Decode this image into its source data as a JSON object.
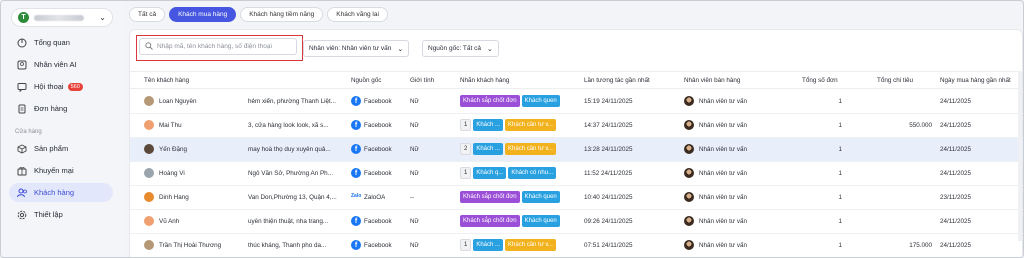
{
  "sidebar": {
    "store_initial": "T",
    "items": [
      {
        "label": "Tổng quan",
        "icon": "dashboard-icon"
      },
      {
        "label": "Nhân viên AI",
        "icon": "ai-agent-icon"
      },
      {
        "label": "Hội thoại",
        "icon": "chat-icon",
        "badge": "560"
      },
      {
        "label": "Đơn hàng",
        "icon": "order-icon"
      },
      {
        "label": "Sản phẩm",
        "icon": "box-icon"
      },
      {
        "label": "Khuyến mại",
        "icon": "promotion-icon"
      },
      {
        "label": "Khách hàng",
        "icon": "customers-icon",
        "active": true
      },
      {
        "label": "Thiết lập",
        "icon": "settings-icon"
      }
    ],
    "section_label": "Cửa hàng"
  },
  "tabs": [
    "Tất cả",
    "Khách mua hàng",
    "Khách hàng tiềm năng",
    "Khách vãng lai"
  ],
  "active_tab": 1,
  "search": {
    "placeholder": "Nhập mã, tên khách hàng, số điện thoại"
  },
  "filters": {
    "staff": "Nhân viên: Nhân viên tư vấn",
    "source": "Nguồn gốc: Tất cả"
  },
  "columns": [
    "Tên khách hàng",
    "Nguồn gốc",
    "Giới tính",
    "Nhãn khách hàng",
    "Lần tương tác gần nhất",
    "Nhân viên bán hàng",
    "Tổng số đơn",
    "Tổng chi tiêu",
    "Ngày mua hàng gần nhất"
  ],
  "rows": [
    {
      "name": "Loan Nguyễn",
      "address": "hẻm xiển, phường Thanh Liệt...",
      "source": "Facebook",
      "gender": "Nữ",
      "tag_count": "",
      "tags": [
        {
          "text": "Khách sắp chốt đơn",
          "color": "purple"
        },
        {
          "text": "Khách quen",
          "color": "blue"
        }
      ],
      "last_interaction": "15:19 24/11/2025",
      "staff": "Nhân viên tư vấn",
      "orders": "1",
      "spend": "",
      "last_purchase": "24/11/2025"
    },
    {
      "name": "Mai Thu",
      "address": "3, cửa hàng look look, xã s...",
      "source": "Facebook",
      "gender": "Nữ",
      "tag_count": "1",
      "tags": [
        {
          "text": "Khách ...",
          "color": "blue"
        },
        {
          "text": "Khách cần tư v...",
          "color": "yellow"
        }
      ],
      "last_interaction": "14:37 24/11/2025",
      "staff": "Nhân viên tư vấn",
      "orders": "1",
      "spend": "550.000",
      "last_purchase": "24/11/2025"
    },
    {
      "name": "Yến Đặng",
      "address": "may hoà thọ duy xuyên quả...",
      "source": "Facebook",
      "gender": "Nữ",
      "tag_count": "2",
      "tags": [
        {
          "text": "Khách ...",
          "color": "blue"
        },
        {
          "text": "Khách cần tư v...",
          "color": "yellow"
        }
      ],
      "last_interaction": "13:28 24/11/2025",
      "staff": "Nhân viên tư vấn",
      "orders": "1",
      "spend": "",
      "last_purchase": "24/11/2025"
    },
    {
      "name": "Hoàng Vi",
      "address": "Ngô Văn Sở, Phường An Ph...",
      "source": "Facebook",
      "gender": "Nữ",
      "tag_count": "1",
      "tags": [
        {
          "text": "Khách q...",
          "color": "blue"
        },
        {
          "text": "Khách có nhu...",
          "color": "blue"
        }
      ],
      "last_interaction": "11:52 24/11/2025",
      "staff": "Nhân viên tư vấn",
      "orders": "1",
      "spend": "",
      "last_purchase": "24/11/2025"
    },
    {
      "name": "Dinh Hang",
      "address": "Van Don,Phường 13, Quận 4,...",
      "source": "ZaloOA",
      "gender": "--",
      "tag_count": "",
      "tags": [
        {
          "text": "Khách sắp chốt đơn",
          "color": "purple"
        },
        {
          "text": "Khách quen",
          "color": "blue"
        }
      ],
      "last_interaction": "10:40 24/11/2025",
      "staff": "Nhân viên tư vấn",
      "orders": "1",
      "spend": "",
      "last_purchase": "23/11/2025"
    },
    {
      "name": "Vũ Anh",
      "address": "uyễn thiện thuật, nha trang...",
      "source": "Facebook",
      "gender": "Nữ",
      "tag_count": "",
      "tags": [
        {
          "text": "Khách sắp chốt đơn",
          "color": "purple"
        },
        {
          "text": "Khách quen",
          "color": "blue"
        }
      ],
      "last_interaction": "09:26 24/11/2025",
      "staff": "Nhân viên tư vấn",
      "orders": "1",
      "spend": "",
      "last_purchase": "24/11/2025"
    },
    {
      "name": "Trần Thị Hoài Thương",
      "address": "thúc kháng, Thanh pho da...",
      "source": "Facebook",
      "gender": "Nữ",
      "tag_count": "1",
      "tags": [
        {
          "text": "Khách ...",
          "color": "blue"
        },
        {
          "text": "Khách cần tư v...",
          "color": "yellow"
        }
      ],
      "last_interaction": "07:51 24/11/2025",
      "staff": "Nhân viên tư vấn",
      "orders": "1",
      "spend": "175.000",
      "last_purchase": "24/11/2025"
    }
  ]
}
